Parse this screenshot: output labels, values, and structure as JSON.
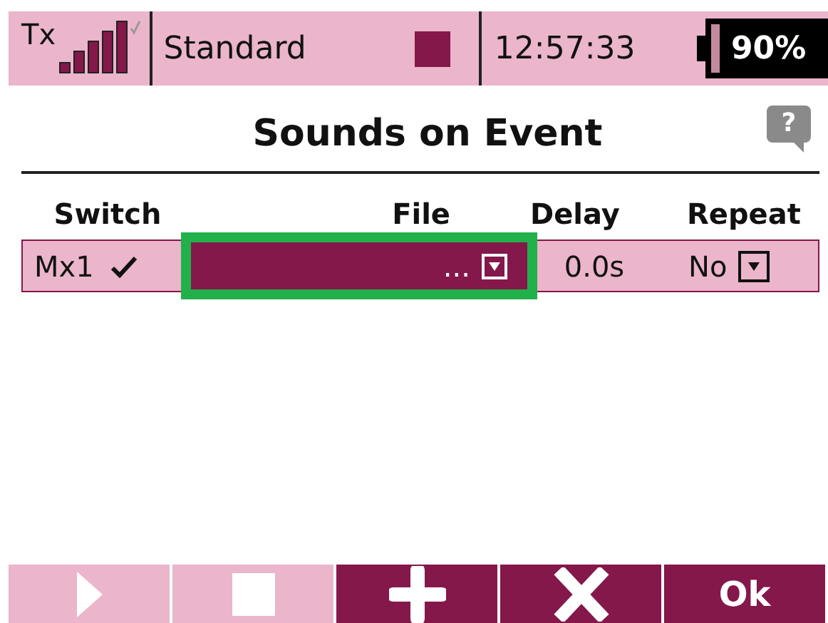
{
  "status_bar": {
    "tx_label": "Tx",
    "model": "Standard",
    "time": "12:57:33",
    "battery": "90%"
  },
  "title": "Sounds on Event",
  "help": "?",
  "table": {
    "columns": [
      "Switch",
      "File",
      "Delay",
      "Repeat"
    ],
    "rows": [
      {
        "switch": "Mx1",
        "file": "...",
        "focused": true,
        "delay": "0.0s",
        "repeat": "No"
      }
    ]
  },
  "buttons": [
    {
      "kind": "play",
      "disabled": true
    },
    {
      "kind": "stop",
      "disabled": true
    },
    {
      "kind": "add",
      "disabled": false
    },
    {
      "kind": "delete",
      "disabled": false
    },
    {
      "kind": "text",
      "label": "Ok",
      "disabled": false
    }
  ]
}
